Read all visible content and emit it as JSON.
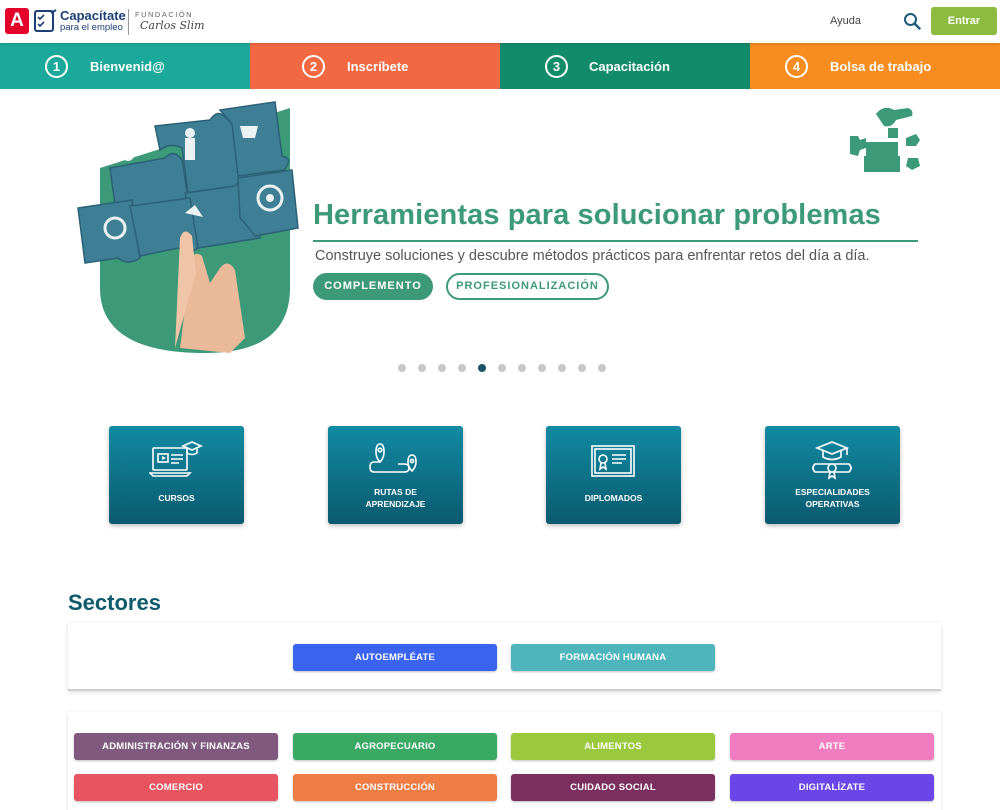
{
  "header": {
    "logo_letter": "A",
    "brand_line1": "Capacítate",
    "brand_line2": "para el empleo",
    "foundation_label": "FUNDACIÓN",
    "foundation_name": "Carlos Slim",
    "help_link": "Ayuda",
    "login_button": "Entrar",
    "login_color": "#8dbb3f"
  },
  "steps": [
    {
      "number": "1",
      "label": "Bienvenid@",
      "color": "#1aa99a"
    },
    {
      "number": "2",
      "label": "Inscríbete",
      "color": "#f26842"
    },
    {
      "number": "3",
      "label": "Capacitación",
      "color": "#118c6a"
    },
    {
      "number": "4",
      "label": "Bolsa de trabajo",
      "color": "#f78d1e"
    }
  ],
  "hero": {
    "title": "Herramientas para solucionar problemas",
    "subtitle": "Construye soluciones y descubre métodos prácticos para enfrentar retos del día a día.",
    "button_primary": "COMPLEMENTO",
    "button_secondary": "PROFESIONALIZACIÓN",
    "accent_color": "#3d9a78",
    "slide_count": 11,
    "active_slide": 5
  },
  "categories": [
    {
      "label_lines": [
        "CURSOS"
      ],
      "icon": "video-course-icon"
    },
    {
      "label_lines": [
        "RUTAS DE",
        "APRENDIZAJE"
      ],
      "icon": "route-icon"
    },
    {
      "label_lines": [
        "DIPLOMADOS"
      ],
      "icon": "diploma-icon"
    },
    {
      "label_lines": [
        "ESPECIALIDADES",
        "OPERATIVAS"
      ],
      "icon": "graduation-scroll-icon"
    }
  ],
  "sectores": {
    "title": "Sectores",
    "featured": [
      {
        "label": "AUTOEMPLÉATE",
        "color": "#3a63f0"
      },
      {
        "label": "FORMACIÓN HUMANA",
        "color": "#4fb5bd"
      }
    ],
    "sectors": [
      {
        "label": "ADMINISTRACIÓN Y FINANZAS",
        "color": "#7f5a7e"
      },
      {
        "label": "AGROPECUARIO",
        "color": "#3aa964"
      },
      {
        "label": "ALIMENTOS",
        "color": "#9bc93d"
      },
      {
        "label": "ARTE",
        "color": "#f27cc0"
      },
      {
        "label": "COMERCIO",
        "color": "#e85560"
      },
      {
        "label": "CONSTRUCCIÓN",
        "color": "#ee7d45"
      },
      {
        "label": "CUIDADO SOCIAL",
        "color": "#7b2f5e"
      },
      {
        "label": "DIGITALÍZATE",
        "color": "#6a45e8"
      }
    ]
  }
}
